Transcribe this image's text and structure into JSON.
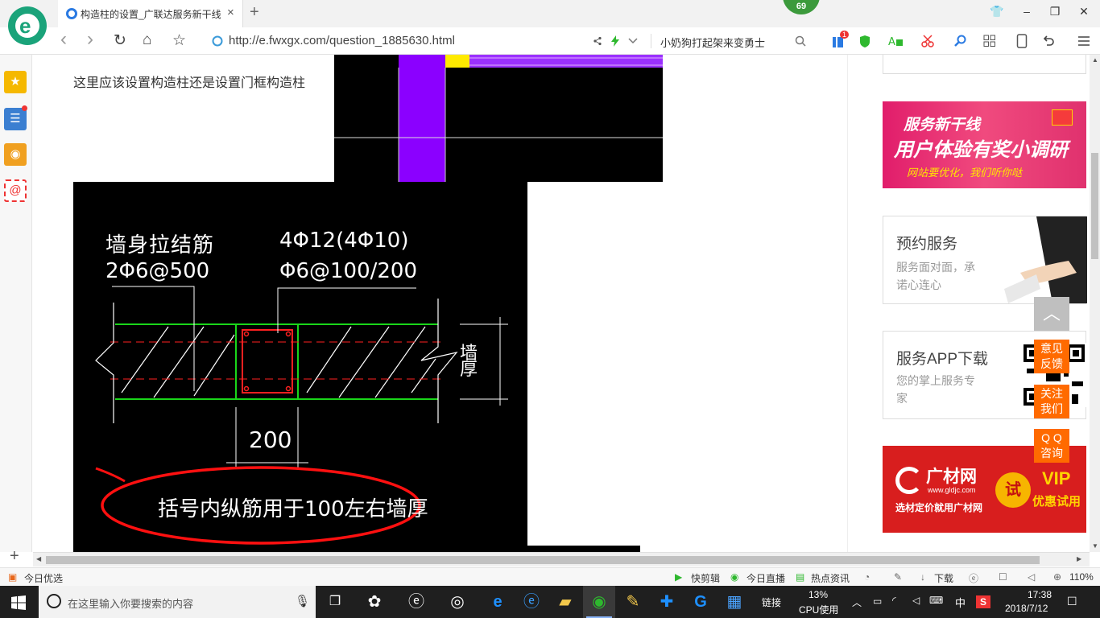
{
  "browser": {
    "tab_title": "构造柱的设置_广联达服务新干线",
    "tab_close": "×",
    "new_tab": "+",
    "badge": "69",
    "url": "http://e.fwxgx.com/question_1885630.html",
    "search_text": "小奶狗打起架来变勇士",
    "window": {
      "skin": "👕",
      "minimize": "–",
      "restore": "❐",
      "close": "✕"
    },
    "nav": {
      "back": "‹",
      "forward": "›",
      "refresh": "↻",
      "home": "⌂",
      "star": "☆"
    },
    "tool_badge": "1"
  },
  "content": {
    "question": "这里应该设置构造柱还是设置门框构造柱",
    "cad": {
      "label1_line1": "墙身拉结筋",
      "label1_line2": "2Φ6@500",
      "label2_line1": "4Φ12(4Φ10)",
      "label2_line2": "Φ6@100/200",
      "wall_label": "墙厚",
      "dim": "200",
      "note": "括号内纵筋用于100左右墙厚"
    }
  },
  "sidebar": {
    "banner1": {
      "title": "服务新干线",
      "main": "用户体验有奖小调研",
      "sub": "网站要优化，我们听你哒"
    },
    "card_booking": {
      "title": "预约服务",
      "line1": "服务面对面，承",
      "line2": "诺心连心"
    },
    "card_app": {
      "title": "服务APP下载",
      "line1": "您的掌上服务专",
      "line2": "家"
    },
    "banner2": {
      "brand": "广材网",
      "url": "www.gldjc.com",
      "slogan": "选材定价就用广材网",
      "trial": "试",
      "vip": "VIP",
      "vip_sub": "优惠试用"
    },
    "float": {
      "back_top": "︿",
      "feedback": [
        "意见",
        "反馈"
      ],
      "follow": [
        "关注",
        "我们"
      ],
      "qq": [
        "Q Q",
        "咨询"
      ]
    }
  },
  "statusbar": {
    "today": "今日优选",
    "clip": "快剪辑",
    "live": "今日直播",
    "news": "热点资讯",
    "download": "下载",
    "zoom": "110%"
  },
  "taskbar": {
    "search_placeholder": "在这里输入你要搜索的内容",
    "links": "链接",
    "cpu_value": "13%",
    "cpu_label": "CPU使用",
    "ime": "中",
    "time": "17:38",
    "date": "2018/7/12"
  },
  "colors": {
    "accent_green": "#1aa37a",
    "orange": "#ff6a00",
    "cad_purple": "#8b00ff"
  }
}
